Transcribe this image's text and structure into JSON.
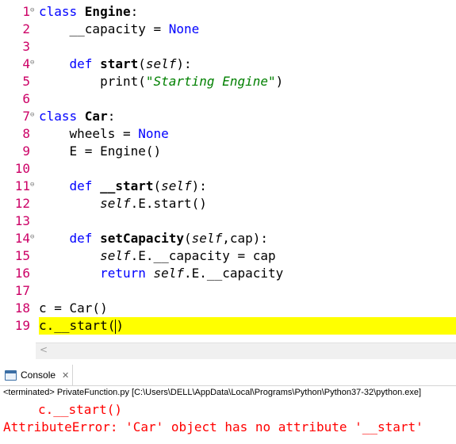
{
  "editor": {
    "lines": [
      {
        "num": "1",
        "fold": true,
        "parts": [
          [
            "kw",
            "class "
          ],
          [
            "bold",
            "Engine"
          ],
          [
            "plain",
            ":"
          ]
        ]
      },
      {
        "num": "2",
        "fold": false,
        "parts": [
          [
            "plain",
            "    __capacity = "
          ],
          [
            "kw",
            "None"
          ]
        ]
      },
      {
        "num": "3",
        "fold": false,
        "parts": []
      },
      {
        "num": "4",
        "fold": true,
        "parts": [
          [
            "plain",
            "    "
          ],
          [
            "kw",
            "def "
          ],
          [
            "bold",
            "start"
          ],
          [
            "plain",
            "("
          ],
          [
            "self",
            "self"
          ],
          [
            "plain",
            "):"
          ]
        ]
      },
      {
        "num": "5",
        "fold": false,
        "parts": [
          [
            "plain",
            "        print("
          ],
          [
            "str",
            "\"Starting Engine\""
          ],
          [
            "plain",
            ")"
          ]
        ]
      },
      {
        "num": "6",
        "fold": false,
        "parts": []
      },
      {
        "num": "7",
        "fold": true,
        "parts": [
          [
            "kw",
            "class "
          ],
          [
            "bold",
            "Car"
          ],
          [
            "plain",
            ":"
          ]
        ]
      },
      {
        "num": "8",
        "fold": false,
        "parts": [
          [
            "plain",
            "    wheels = "
          ],
          [
            "kw",
            "None"
          ]
        ]
      },
      {
        "num": "9",
        "fold": false,
        "parts": [
          [
            "plain",
            "    E = Engine()"
          ]
        ]
      },
      {
        "num": "10",
        "fold": false,
        "parts": []
      },
      {
        "num": "11",
        "fold": true,
        "parts": [
          [
            "plain",
            "    "
          ],
          [
            "kw",
            "def "
          ],
          [
            "bold",
            "__start"
          ],
          [
            "plain",
            "("
          ],
          [
            "self",
            "self"
          ],
          [
            "plain",
            "):"
          ]
        ]
      },
      {
        "num": "12",
        "fold": false,
        "parts": [
          [
            "plain",
            "        "
          ],
          [
            "self",
            "self"
          ],
          [
            "plain",
            ".E.start()"
          ]
        ]
      },
      {
        "num": "13",
        "fold": false,
        "parts": []
      },
      {
        "num": "14",
        "fold": true,
        "parts": [
          [
            "plain",
            "    "
          ],
          [
            "kw",
            "def "
          ],
          [
            "bold",
            "setCapacity"
          ],
          [
            "plain",
            "("
          ],
          [
            "self",
            "self"
          ],
          [
            "plain",
            ",cap):"
          ]
        ]
      },
      {
        "num": "15",
        "fold": false,
        "parts": [
          [
            "plain",
            "        "
          ],
          [
            "self",
            "self"
          ],
          [
            "plain",
            ".E.__capacity = cap"
          ]
        ]
      },
      {
        "num": "16",
        "fold": false,
        "parts": [
          [
            "plain",
            "        "
          ],
          [
            "kw",
            "return "
          ],
          [
            "self",
            "self"
          ],
          [
            "plain",
            ".E.__capacity"
          ]
        ]
      },
      {
        "num": "17",
        "fold": false,
        "parts": []
      },
      {
        "num": "18",
        "fold": false,
        "parts": [
          [
            "plain",
            "c = Car()"
          ]
        ]
      },
      {
        "num": "19",
        "fold": false,
        "current": true,
        "parts": [
          [
            "plain",
            "c.__start("
          ],
          [
            "caret",
            ""
          ],
          [
            "plain",
            ")"
          ]
        ]
      }
    ],
    "scroll_arrow": "<"
  },
  "console": {
    "tab_label": "Console",
    "close_glyph": "✕",
    "terminated_text": "<terminated> PrivateFunction.py [C:\\Users\\DELL\\AppData\\Local\\Programs\\Python\\Python37-32\\python.exe]",
    "error_line1": "c.__start()",
    "error_line2": "AttributeError: 'Car' object has no attribute '__start'"
  },
  "colors": {
    "line_number": "#cc0066",
    "keyword": "#0000ff",
    "string": "#008000",
    "current_line": "#ffff00",
    "error": "#ff0000"
  }
}
